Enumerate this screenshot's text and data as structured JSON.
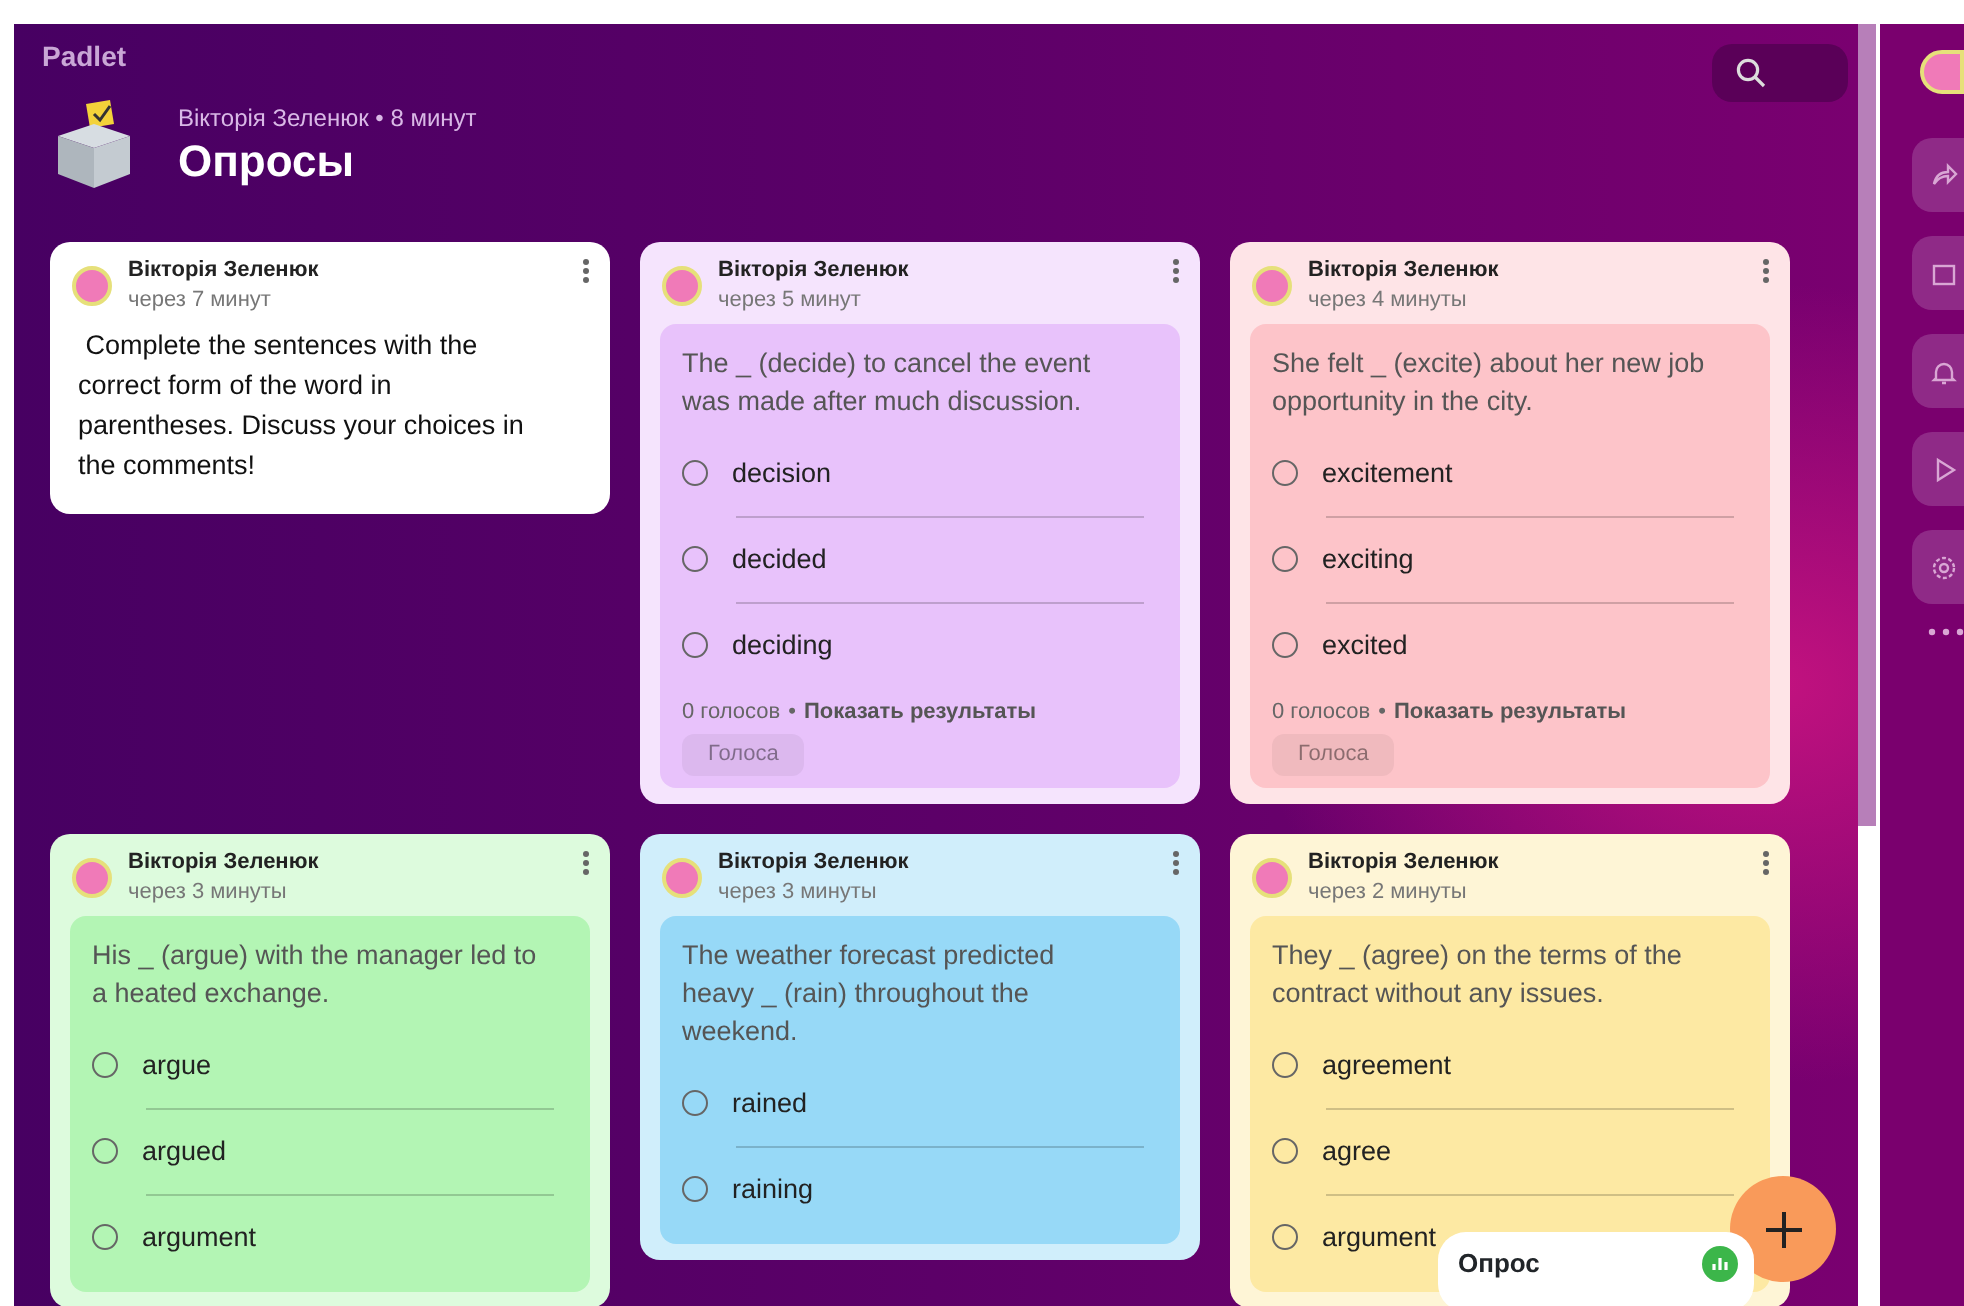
{
  "header": {
    "brand": "Padlet",
    "author_line": "Вікторія Зеленюк • 8 минут",
    "title": "Опросы"
  },
  "cards": [
    {
      "kind": "note",
      "color": "#ffffff",
      "author": "Вікторія Зеленюк",
      "time": "через 7 минут",
      "text": " Complete the sentences with the correct form of the word in parentheses. Discuss your choices in the comments!"
    },
    {
      "kind": "poll",
      "color": "#e8c2fb",
      "author": "Вікторія Зеленюк",
      "time": "через 5 минут",
      "question": "The _ (decide) to cancel the event was made after much discussion.",
      "options": [
        {
          "label": "decision",
          "selected": false
        },
        {
          "label": "decided",
          "selected": false
        },
        {
          "label": "deciding",
          "selected": false
        }
      ],
      "votes": "0 голосов",
      "separator": "•",
      "results_link": "Показать результаты",
      "vote_button": {
        "label": "Голоса",
        "disabled": true
      }
    },
    {
      "kind": "poll",
      "color": "#fdc4c9",
      "author": "Вікторія Зеленюк",
      "time": "через 4 минуты",
      "question": "She felt _ (excite) about her new job opportunity in the city.",
      "options": [
        {
          "label": "excitement",
          "selected": false
        },
        {
          "label": "exciting",
          "selected": false
        },
        {
          "label": "excited",
          "selected": false
        }
      ],
      "votes": "0 голосов",
      "separator": "•",
      "results_link": "Показать результаты",
      "vote_button": {
        "label": "Голоса",
        "disabled": true
      }
    },
    {
      "kind": "poll",
      "color": "#b3f5b4",
      "author": "Вікторія Зеленюк",
      "time": "через 3 минуты",
      "question": "His _ (argue) with the manager led to a heated exchange.",
      "options": [
        {
          "label": "argue",
          "selected": false
        },
        {
          "label": "argued",
          "selected": false
        },
        {
          "label": "argument",
          "selected": false
        }
      ]
    },
    {
      "kind": "poll",
      "color": "#97d9f7",
      "author": "Вікторія Зеленюк",
      "time": "через 3 минуты",
      "question": "The weather forecast predicted heavy _ (rain) throughout the weekend.",
      "options": [
        {
          "label": "rained",
          "selected": false
        },
        {
          "label": "raining",
          "selected": false
        }
      ]
    },
    {
      "kind": "poll",
      "color": "#fde9a3",
      "author": "Вікторія Зеленюк",
      "time": "через 2 минуты",
      "question": "They _ (agree) on the terms of the contract without any issues.",
      "options": [
        {
          "label": "agreement",
          "selected": false
        },
        {
          "label": "agree",
          "selected": false
        },
        {
          "label": "argument",
          "selected": false
        }
      ]
    }
  ],
  "popup": {
    "label": "Опрос"
  }
}
